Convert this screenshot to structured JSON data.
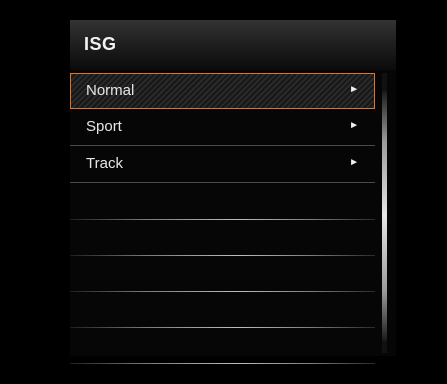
{
  "menu": {
    "title": "ISG",
    "items": [
      {
        "label": "Normal",
        "arrow": "►",
        "selected": true
      },
      {
        "label": "Sport",
        "arrow": "►",
        "selected": false
      },
      {
        "label": "Track",
        "arrow": "►",
        "selected": false
      }
    ]
  },
  "scrollbar": {
    "thumb_fraction": 0.9
  },
  "colors": {
    "selection_border": "#e07420",
    "background": "#000000",
    "text": "#e6e6e6"
  }
}
